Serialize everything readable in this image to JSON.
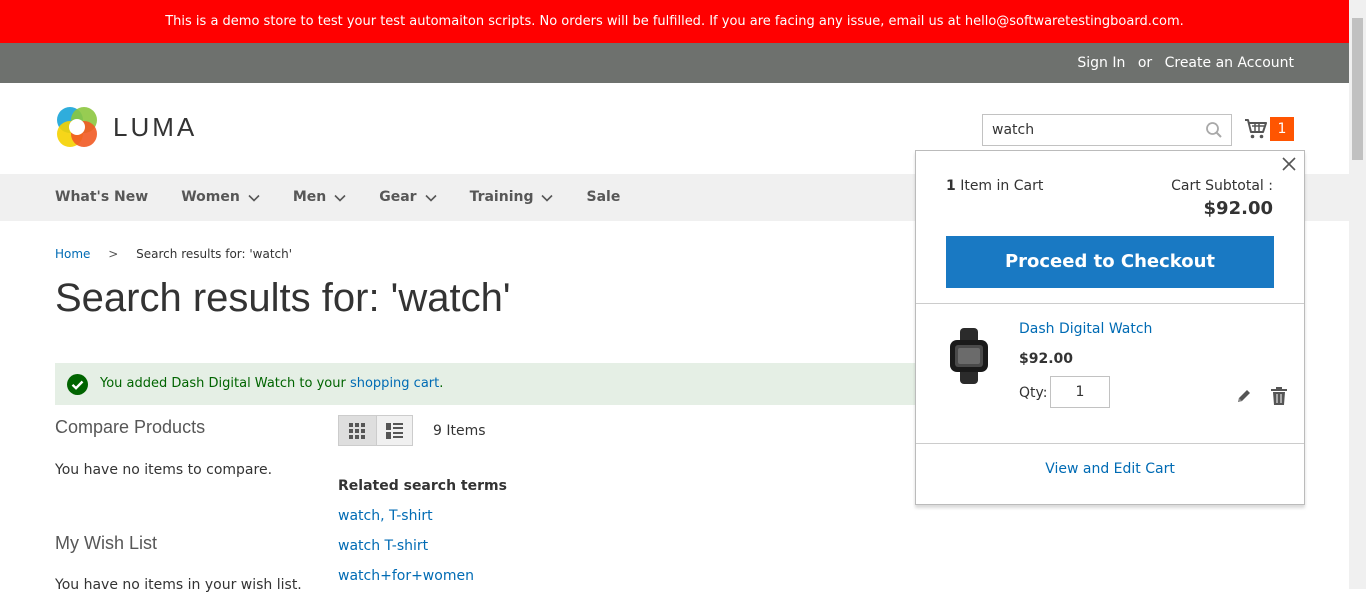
{
  "demo_notice": "This is a demo store to test your test automaiton scripts. No orders will be fulfilled. If you are facing any issue, email us at hello@softwaretestingboard.com.",
  "header_links": {
    "sign_in": "Sign In",
    "or": "or",
    "create_account": "Create an Account"
  },
  "logo": {
    "text": "LUMA"
  },
  "search": {
    "value": "watch"
  },
  "minicart": {
    "count": "1"
  },
  "nav": {
    "items": [
      {
        "label": "What's New",
        "has_chevron": false
      },
      {
        "label": "Women",
        "has_chevron": true
      },
      {
        "label": "Men",
        "has_chevron": true
      },
      {
        "label": "Gear",
        "has_chevron": true
      },
      {
        "label": "Training",
        "has_chevron": true
      },
      {
        "label": "Sale",
        "has_chevron": false
      }
    ]
  },
  "breadcrumb": {
    "home": "Home",
    "current": "Search results for: 'watch'"
  },
  "page_title": "Search results for: 'watch'",
  "message": {
    "prefix": "You added Dash Digital Watch to your ",
    "link": "shopping cart",
    "suffix": "."
  },
  "sidebar": {
    "compare_title": "Compare Products",
    "compare_empty": "You have no items to compare.",
    "wishlist_title": "My Wish List",
    "wishlist_empty": "You have no items in your wish list."
  },
  "toolbar": {
    "items_count": "9 Items"
  },
  "related": {
    "title": "Related search terms",
    "terms": [
      "watch, T-shirt",
      "watch T-shirt",
      "watch+for+women"
    ]
  },
  "cart_dropdown": {
    "count": "1",
    "items_label": " Item in Cart",
    "subtotal_label": "Cart Subtotal :",
    "subtotal": "$92.00",
    "checkout_label": "Proceed to Checkout",
    "product": {
      "name": "Dash Digital Watch",
      "price": "$92.00",
      "qty_label": "Qty:",
      "qty": "1"
    },
    "view_cart_label": "View and Edit Cart"
  },
  "colors": {
    "demo_bar": "#ff0000",
    "panel": "#6e716e",
    "accent": "#1979c3",
    "link": "#006bb4",
    "badge": "#ff5501"
  }
}
